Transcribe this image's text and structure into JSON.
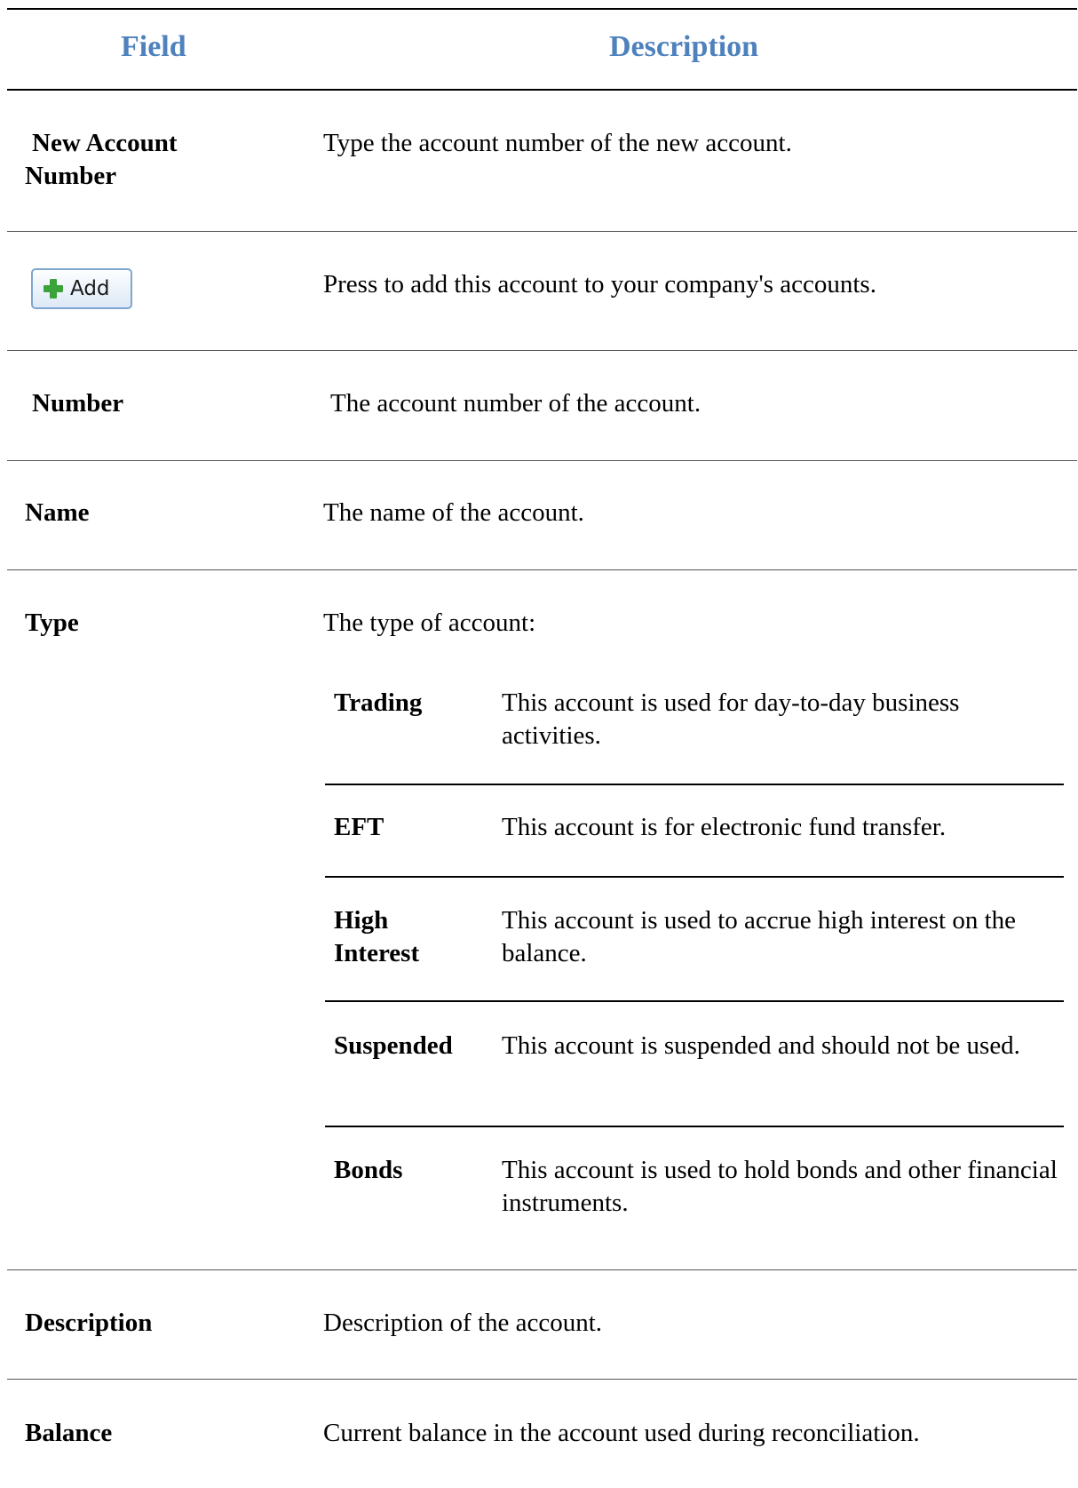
{
  "header": {
    "field": "Field",
    "description": "Description"
  },
  "rows": [
    {
      "field": "New Account Number",
      "description": "Type the account number of the new account."
    },
    {
      "button_label": "Add",
      "button_icon": "plus-icon",
      "description": "Press to add this account to your company's accounts."
    },
    {
      "field": "Number",
      "description": "The account number of the account."
    },
    {
      "field": "Name",
      "description": "The name of the account."
    },
    {
      "field": "Type",
      "description": "The type of account:",
      "options": [
        {
          "name": "Trading",
          "description": "This account is used for day-to-day business activities."
        },
        {
          "name": "EFT",
          "description": "This account is for electronic fund transfer."
        },
        {
          "name": "High Interest",
          "description": "This account is used to accrue high interest on the balance."
        },
        {
          "name": "Suspended",
          "description": "This account is suspended and should not be used."
        },
        {
          "name": "Bonds",
          "description": "This account is used to hold bonds and other financial instruments."
        }
      ]
    },
    {
      "field": "Description",
      "description": "Description of the account."
    },
    {
      "field": "Balance",
      "description": "Current balance in the account used during reconciliation."
    }
  ],
  "colors": {
    "header_text": "#4f81bd",
    "add_icon": "#3aa33a"
  }
}
